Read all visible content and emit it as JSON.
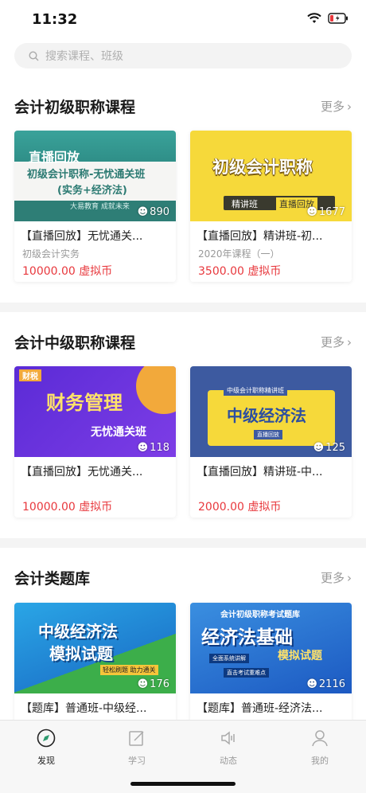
{
  "status": {
    "time": "11:32"
  },
  "search": {
    "placeholder": "搜索课程、班级"
  },
  "sections": [
    {
      "title": "会计初级职称课程",
      "more": "更多",
      "cards": [
        {
          "title": "【直播回放】无忧通关...",
          "subtitle": "初级会计实务",
          "price": "10000.00 虚拟币",
          "count": "890",
          "thumb": {
            "badge": "直播回放",
            "line1": "初级会计职称-无忧通关班",
            "line2": "(实务+经济法)",
            "line3": "大易教育  成就未来"
          }
        },
        {
          "title": "【直播回放】精讲班-初...",
          "subtitle": "2020年课程（一）",
          "price": "3500.00 虚拟币",
          "count": "1677",
          "thumb": {
            "headline": "初级会计职称",
            "tag1": "精讲班",
            "tag2": "直播回放"
          }
        }
      ]
    },
    {
      "title": "会计中级职称课程",
      "more": "更多",
      "cards": [
        {
          "title": "【直播回放】无忧通关...",
          "subtitle": "",
          "price": "10000.00 虚拟币",
          "count": "118",
          "thumb": {
            "corner": "财税",
            "headline": "财务管理",
            "sub": "无忧通关班"
          }
        },
        {
          "title": "【直播回放】精讲班-中...",
          "subtitle": "",
          "price": "2000.00 虚拟币",
          "count": "125",
          "thumb": {
            "top": "中级会计职称精讲班",
            "headline": "中级经济法",
            "tag": "直播回放"
          }
        }
      ]
    },
    {
      "title": "会计类题库",
      "more": "更多",
      "cards": [
        {
          "title": "【题库】普通班-中级经...",
          "count": "176",
          "thumb": {
            "line1": "中级经济法",
            "line2": "模拟试题",
            "tag": "轻松刷题  助力通关"
          }
        },
        {
          "title": "【题库】普通班-经济法...",
          "count": "2116",
          "thumb": {
            "top": "会计初级职称考试题库",
            "headline": "经济法基础",
            "sub": "模拟试题",
            "tag1": "全面系统讲解",
            "tag2": "直击考试重难点"
          }
        }
      ]
    }
  ],
  "tabs": [
    {
      "label": "发现",
      "icon": "compass-icon",
      "active": true
    },
    {
      "label": "学习",
      "icon": "edit-icon"
    },
    {
      "label": "动态",
      "icon": "speaker-icon"
    },
    {
      "label": "我的",
      "icon": "person-icon"
    }
  ],
  "colors": {
    "price": "#e8383d",
    "accent_tab": "#2e9b6f"
  }
}
